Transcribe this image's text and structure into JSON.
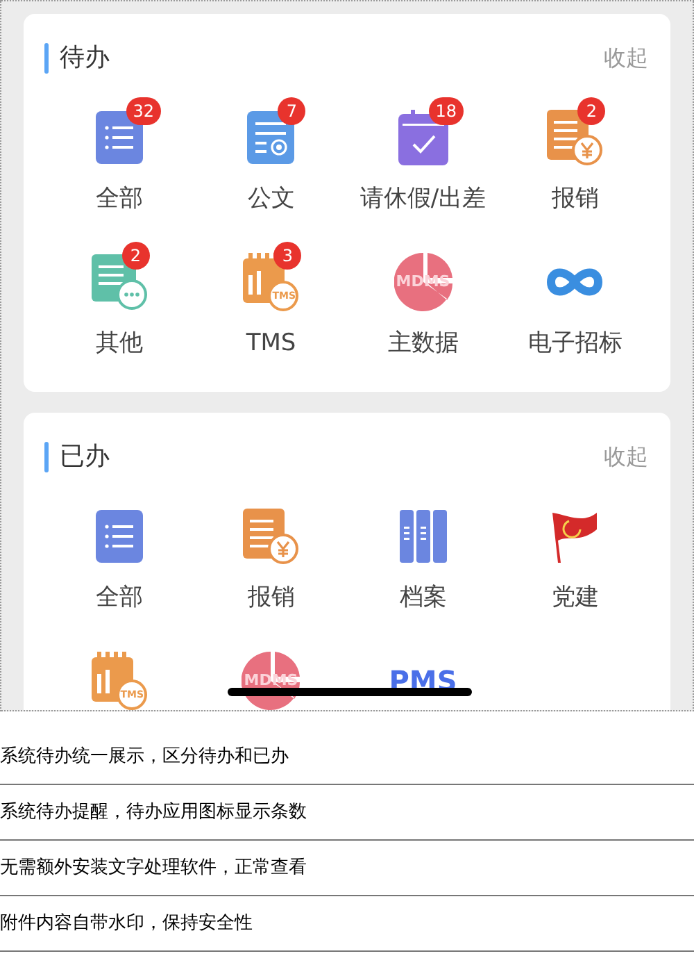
{
  "sections": [
    {
      "title": "待办",
      "action": "收起",
      "items": [
        {
          "kind": "list",
          "label": "全部",
          "badge": "32"
        },
        {
          "kind": "document",
          "label": "公文",
          "badge": "7"
        },
        {
          "kind": "calendar",
          "label": "请休假/出差",
          "badge": "18"
        },
        {
          "kind": "expense",
          "label": "报销",
          "badge": "2"
        },
        {
          "kind": "chat",
          "label": "其他",
          "badge": "2"
        },
        {
          "kind": "tms",
          "label": "TMS",
          "badge": "3",
          "icon_text": "TMS"
        },
        {
          "kind": "mdms",
          "label": "主数据",
          "icon_text": "MDMS"
        },
        {
          "kind": "infinity",
          "label": "电子招标"
        }
      ]
    },
    {
      "title": "已办",
      "action": "收起",
      "items": [
        {
          "kind": "list",
          "label": "全部"
        },
        {
          "kind": "expense",
          "label": "报销"
        },
        {
          "kind": "archive",
          "label": "档案"
        },
        {
          "kind": "flag",
          "label": "党建"
        },
        {
          "kind": "tms",
          "icon_text": "TMS"
        },
        {
          "kind": "mdms",
          "icon_text": "MDMS"
        },
        {
          "kind": "pms",
          "icon_text": "PMS"
        }
      ]
    }
  ],
  "features": [
    "系统待办统一展示，区分待办和已办",
    "系统待办提醒，待办应用图标显示条数",
    "无需额外安装文字处理软件，正常查看",
    "附件内容自带水印，保持安全性"
  ]
}
